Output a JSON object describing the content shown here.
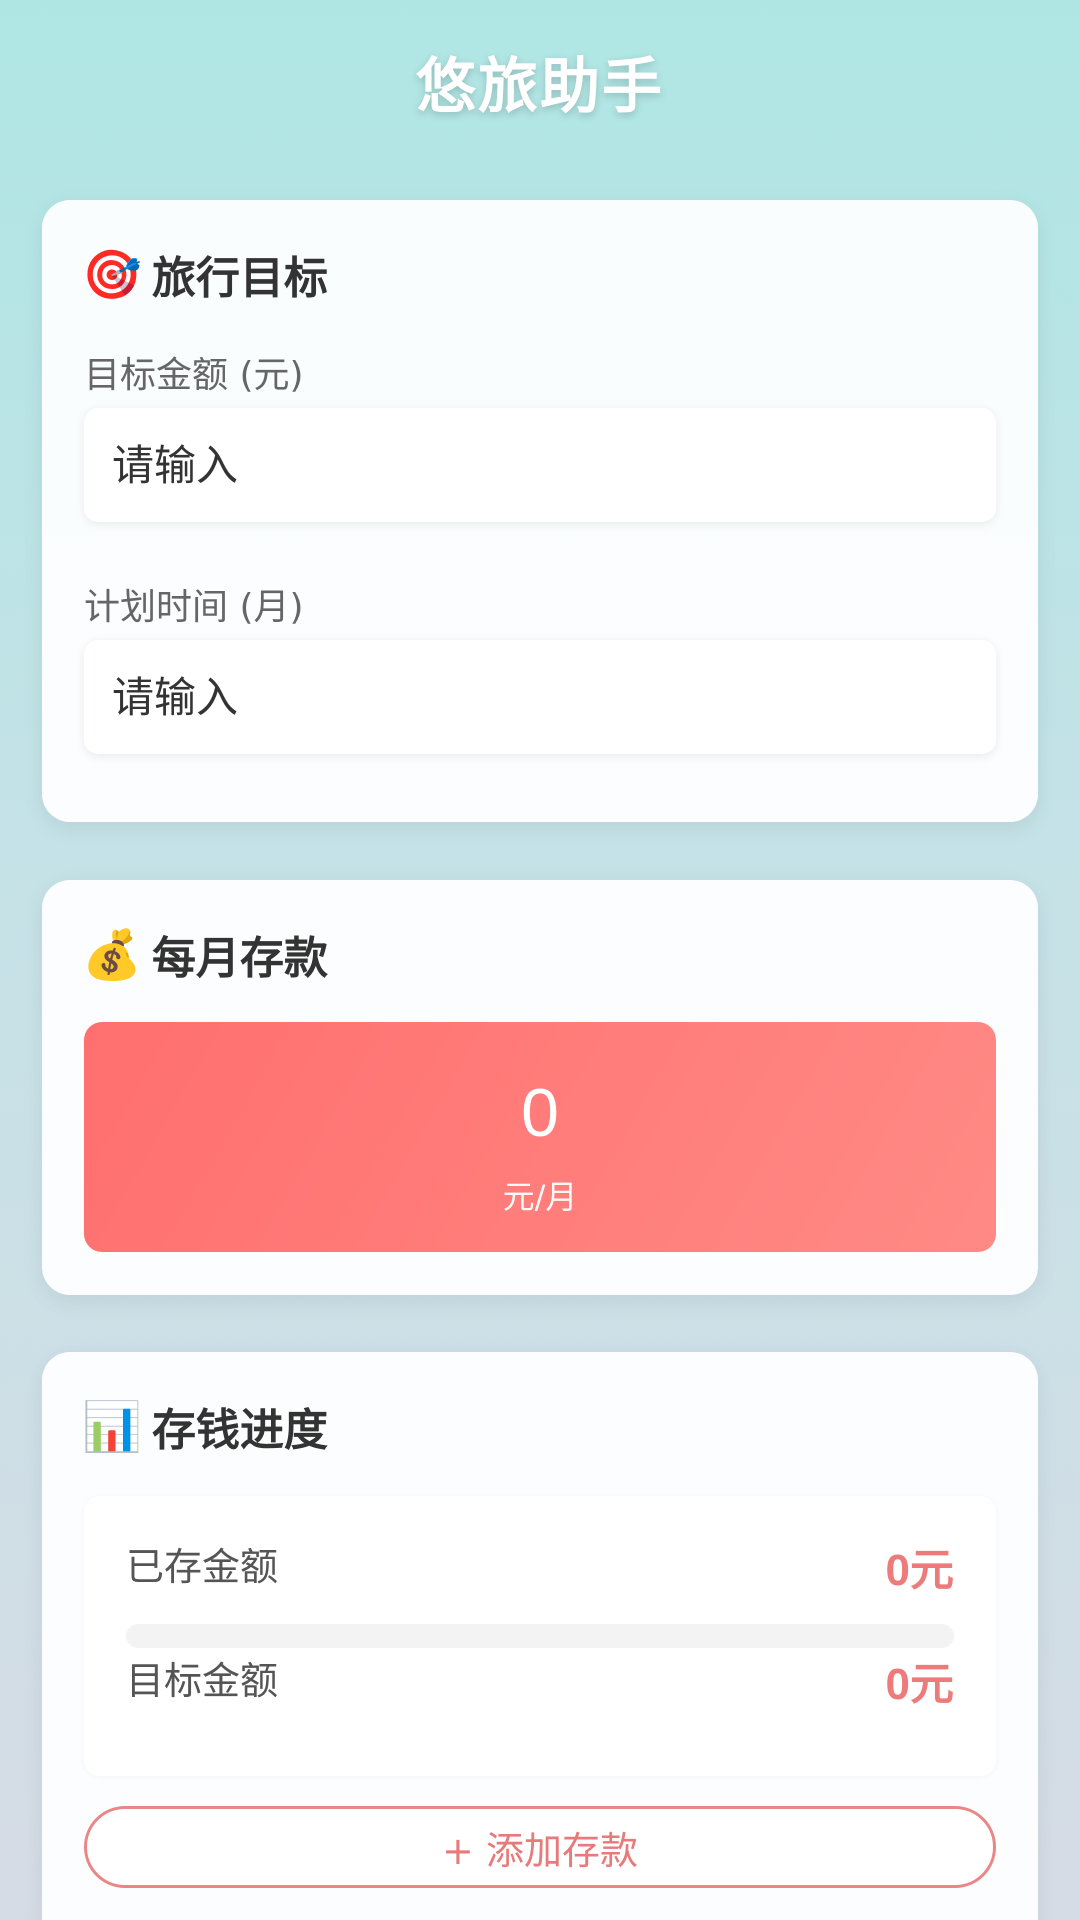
{
  "app": {
    "title": "悠旅助手"
  },
  "goal_card": {
    "icon": "target-icon",
    "icon_glyph": "🎯",
    "title": "旅行目标",
    "amount_label": "目标金额 (元)",
    "amount_placeholder": "请输入",
    "amount_value": "",
    "months_label": "计划时间 (月)",
    "months_placeholder": "请输入",
    "months_value": ""
  },
  "monthly_card": {
    "icon": "money-bag-icon",
    "icon_glyph": "💰",
    "title": "每月存款",
    "value": "0",
    "unit": "元/月"
  },
  "progress_card": {
    "icon": "bar-chart-icon",
    "icon_glyph": "📊",
    "title": "存钱进度",
    "saved_label": "已存金额",
    "saved_value": "0元",
    "target_label": "目标金额",
    "target_value": "0元",
    "progress_percent": 0,
    "add_button_label": "+ 添加存款"
  },
  "colors": {
    "accent": "#ee7b7b",
    "monthly_gradient_start": "#ff6f6f",
    "monthly_gradient_end": "#ff8a85",
    "background_top": "#afe6e4"
  }
}
